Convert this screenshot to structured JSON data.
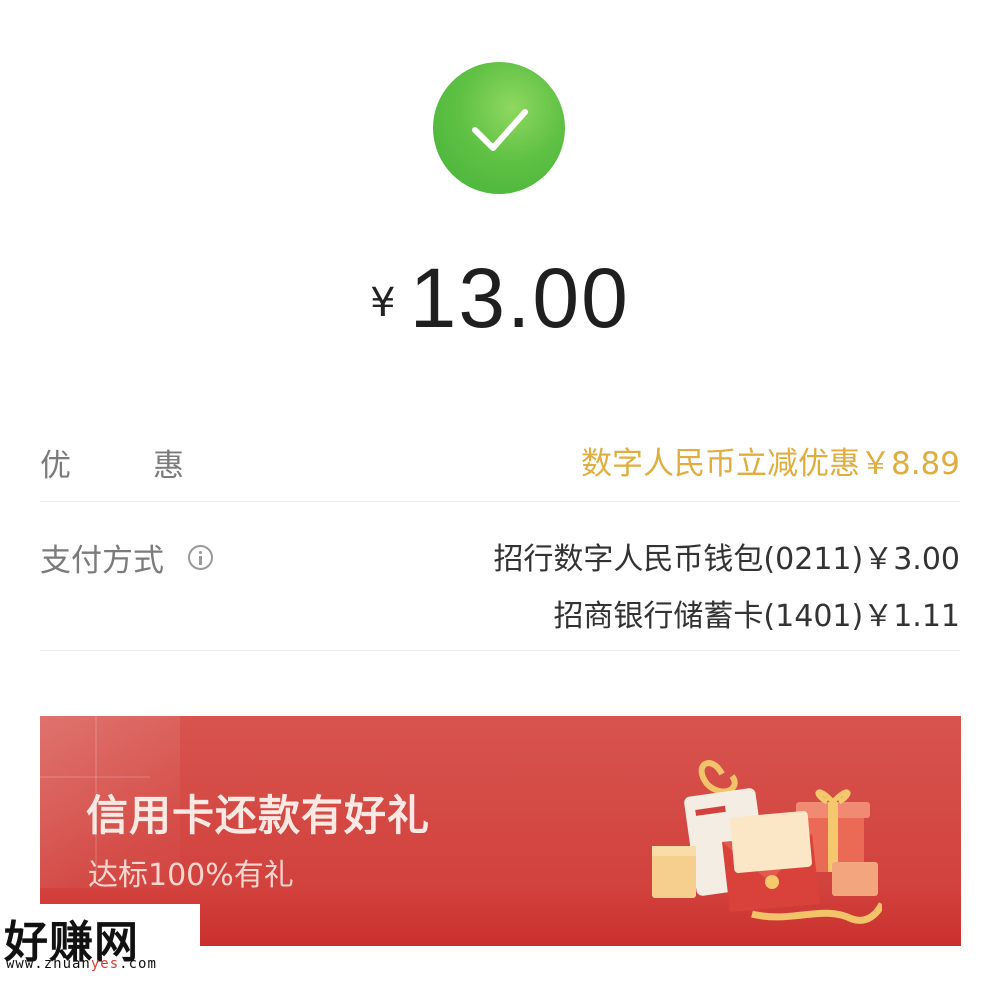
{
  "status": {
    "icon": "check-icon",
    "color": "#5fc144"
  },
  "amount": {
    "currency": "¥",
    "value": "13.00"
  },
  "discount": {
    "label_left": "优",
    "label_right": "惠",
    "value": "数字人民币立减优惠￥8.89",
    "color": "#e0ad3e"
  },
  "payment": {
    "label": "支付方式",
    "info_icon": "info-icon",
    "methods": [
      "招行数字人民币钱包(0211)￥3.00",
      "招商银行储蓄卡(1401)￥1.11"
    ]
  },
  "banner": {
    "title": "信用卡还款有好礼",
    "subtitle": "达标100%有礼",
    "color": "#d2413d"
  },
  "watermark": {
    "logo": "好赚网",
    "url_prefix": "www.zhuan",
    "url_highlight": "yes",
    "url_suffix": ".com"
  }
}
